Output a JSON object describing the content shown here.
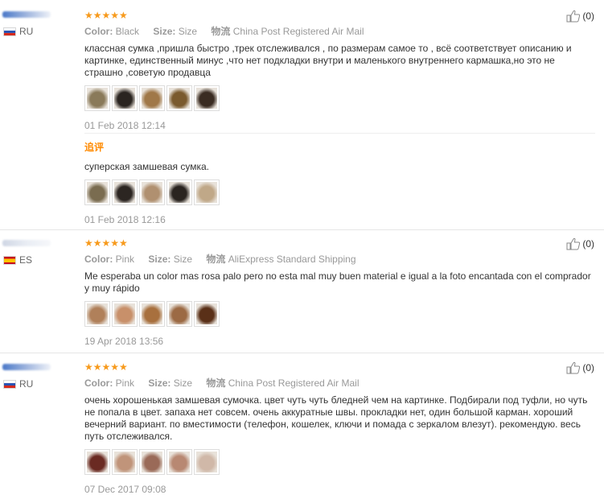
{
  "reviews": [
    {
      "country": "RU",
      "stars": "★★★★★",
      "color_label": "Color:",
      "color_value": "Black",
      "size_label": "Size:",
      "size_value": "Size",
      "shipping_label": "物流",
      "shipping_value": "China Post Registered Air Mail",
      "text": "классная сумка ,пришла быстро ,трек отслеживался , по размерам самое то , всё соответствует описанию и картинке, единственный минус ,что нет подкладки внутри и маленького внутреннего кармашка,но это не страшно ,советую продавца",
      "date": "01 Feb 2018 12:14",
      "helpful_count": "(0)",
      "thumb_colors": [
        "#8a7a5a",
        "#2a2420",
        "#a07848",
        "#7a5a2e",
        "#3a2c22"
      ],
      "additional": {
        "title": "追评",
        "text": "суперская замшевая сумка.",
        "date": "01 Feb 2018 12:16",
        "thumb_colors": [
          "#7a6c50",
          "#2c2622",
          "#b09070",
          "#2a2420",
          "#c0a888"
        ]
      }
    },
    {
      "country": "ES",
      "stars": "★★★★★",
      "color_label": "Color:",
      "color_value": "Pink",
      "size_label": "Size:",
      "size_value": "Size",
      "shipping_label": "物流",
      "shipping_value": "AliExpress Standard Shipping",
      "text": "Me esperaba un color mas rosa palo pero no esta mal muy buen material e igual a la foto encantada con el comprador y muy rápido",
      "date": "19 Apr 2018 13:56",
      "helpful_count": "(0)",
      "thumb_colors": [
        "#b0805a",
        "#c8906a",
        "#a8703e",
        "#9c6a44",
        "#5a3018"
      ]
    },
    {
      "country": "RU",
      "stars": "★★★★★",
      "color_label": "Color:",
      "color_value": "Pink",
      "size_label": "Size:",
      "size_value": "Size",
      "shipping_label": "物流",
      "shipping_value": "China Post Registered Air Mail",
      "text": "очень хорошенькая замшевая сумочка. цвет чуть чуть бледней чем на картинке. Подбирали под туфли, но чуть не попала в цвет. запаха нет совсем. очень аккуратные швы. прокладки нет, один большой карман. хороший вечерний вариант. по вместимости (телефон, кошелек, ключи и помада с зеркалом влезут). рекомендую. весь путь отслеживался.",
      "date": "07 Dec 2017 09:08",
      "helpful_count": "(0)",
      "thumb_colors": [
        "#6a2a22",
        "#c0947a",
        "#9a6a58",
        "#b88872",
        "#d0b8a8"
      ]
    }
  ]
}
